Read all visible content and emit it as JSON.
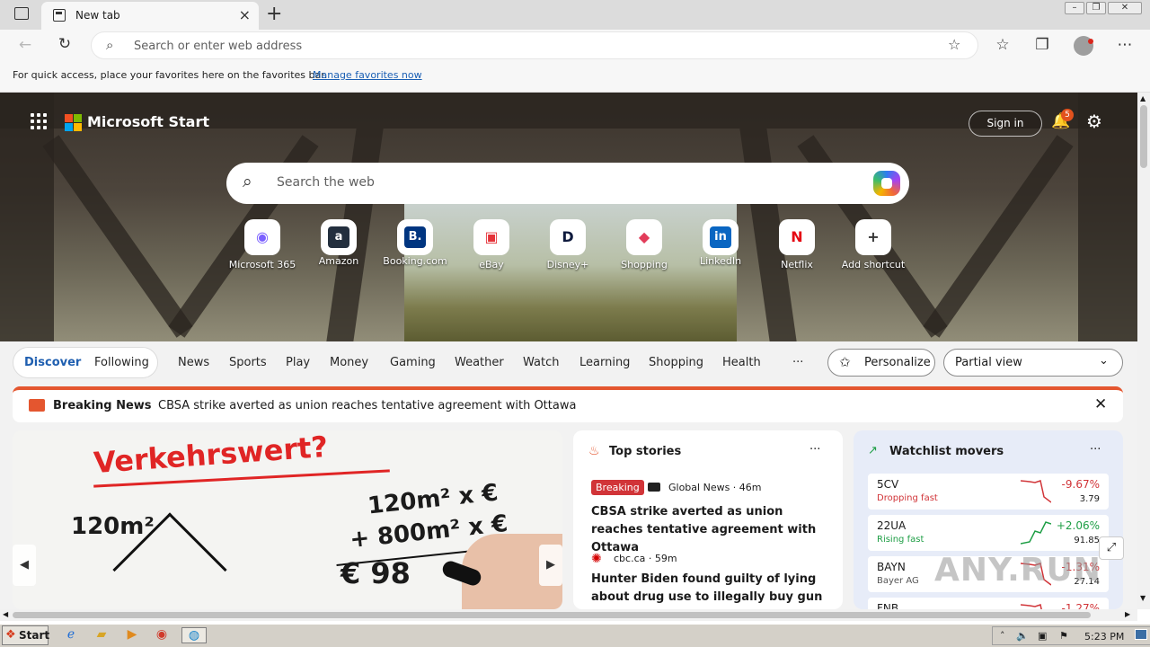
{
  "browser": {
    "tab_title": "New tab",
    "address_placeholder": "Search or enter web address",
    "favorites_bar_text": "For quick access, place your favorites here on the favorites bar.",
    "favorites_bar_link": "Manage favorites now"
  },
  "header": {
    "brand": "Microsoft Start",
    "sign_in": "Sign in",
    "notification_count": "5",
    "search_placeholder": "Search the web"
  },
  "shortcuts": [
    {
      "label": "Microsoft 365",
      "glyph": "◉",
      "color": "#7b61ff"
    },
    {
      "label": "Amazon",
      "glyph": "a",
      "color": "#ffffff",
      "bg": "#232f3e"
    },
    {
      "label": "Booking.com",
      "glyph": "B.",
      "color": "#ffffff",
      "bg": "#003580"
    },
    {
      "label": "eBay",
      "glyph": "▣",
      "color": "#e53238"
    },
    {
      "label": "Disney+",
      "glyph": "D",
      "color": "#0e1a3d"
    },
    {
      "label": "Shopping",
      "glyph": "◆",
      "color": "#e23c5a"
    },
    {
      "label": "LinkedIn",
      "glyph": "in",
      "color": "#ffffff",
      "bg": "#0a66c2"
    },
    {
      "label": "Netflix",
      "glyph": "N",
      "color": "#e50914"
    },
    {
      "label": "Add shortcut",
      "glyph": "+",
      "color": "#333333"
    }
  ],
  "feed_nav": {
    "discover": "Discover",
    "following": "Following",
    "items": [
      "News",
      "Sports",
      "Play",
      "Money",
      "Gaming",
      "Weather",
      "Watch",
      "Learning",
      "Shopping",
      "Health"
    ],
    "more": "···",
    "personalize": "Personalize",
    "view": "Partial view"
  },
  "breaking": {
    "label": "Breaking News",
    "headline": "CBSA strike averted as union reaches tentative agreement with Ottawa"
  },
  "hero_image": {
    "title": "Verkehrswert?",
    "line1": "120m²",
    "line2": "120m² x €",
    "line3": "+ 800m² x €",
    "line4": "€ 98"
  },
  "top_stories": {
    "title": "Top stories",
    "more": "···",
    "items": [
      {
        "tag": "Breaking",
        "source": "Global News · 46m",
        "headline": "CBSA strike averted as union reaches tentative agreement with Ottawa"
      },
      {
        "tag": "",
        "source": "cbc.ca · 59m",
        "headline": "Hunter Biden found guilty of lying about drug use to illegally buy gun"
      }
    ]
  },
  "watchlist": {
    "title": "Watchlist movers",
    "more": "···",
    "items": [
      {
        "symbol": "5CV",
        "sub": "Dropping fast",
        "change": "-9.67%",
        "price": "3.79",
        "up": false
      },
      {
        "symbol": "22UA",
        "sub": "Rising fast",
        "change": "+2.06%",
        "price": "91.85",
        "up": true
      },
      {
        "symbol": "BAYN",
        "sub": "Bayer AG",
        "change": "-1.31%",
        "price": "27.14",
        "up": false
      },
      {
        "symbol": "FNB",
        "sub": "",
        "change": "-1.27%",
        "price": "",
        "up": false
      }
    ]
  },
  "taskbar": {
    "start": "Start",
    "time": "5:23 PM"
  },
  "watermark": "ANY.RUN"
}
